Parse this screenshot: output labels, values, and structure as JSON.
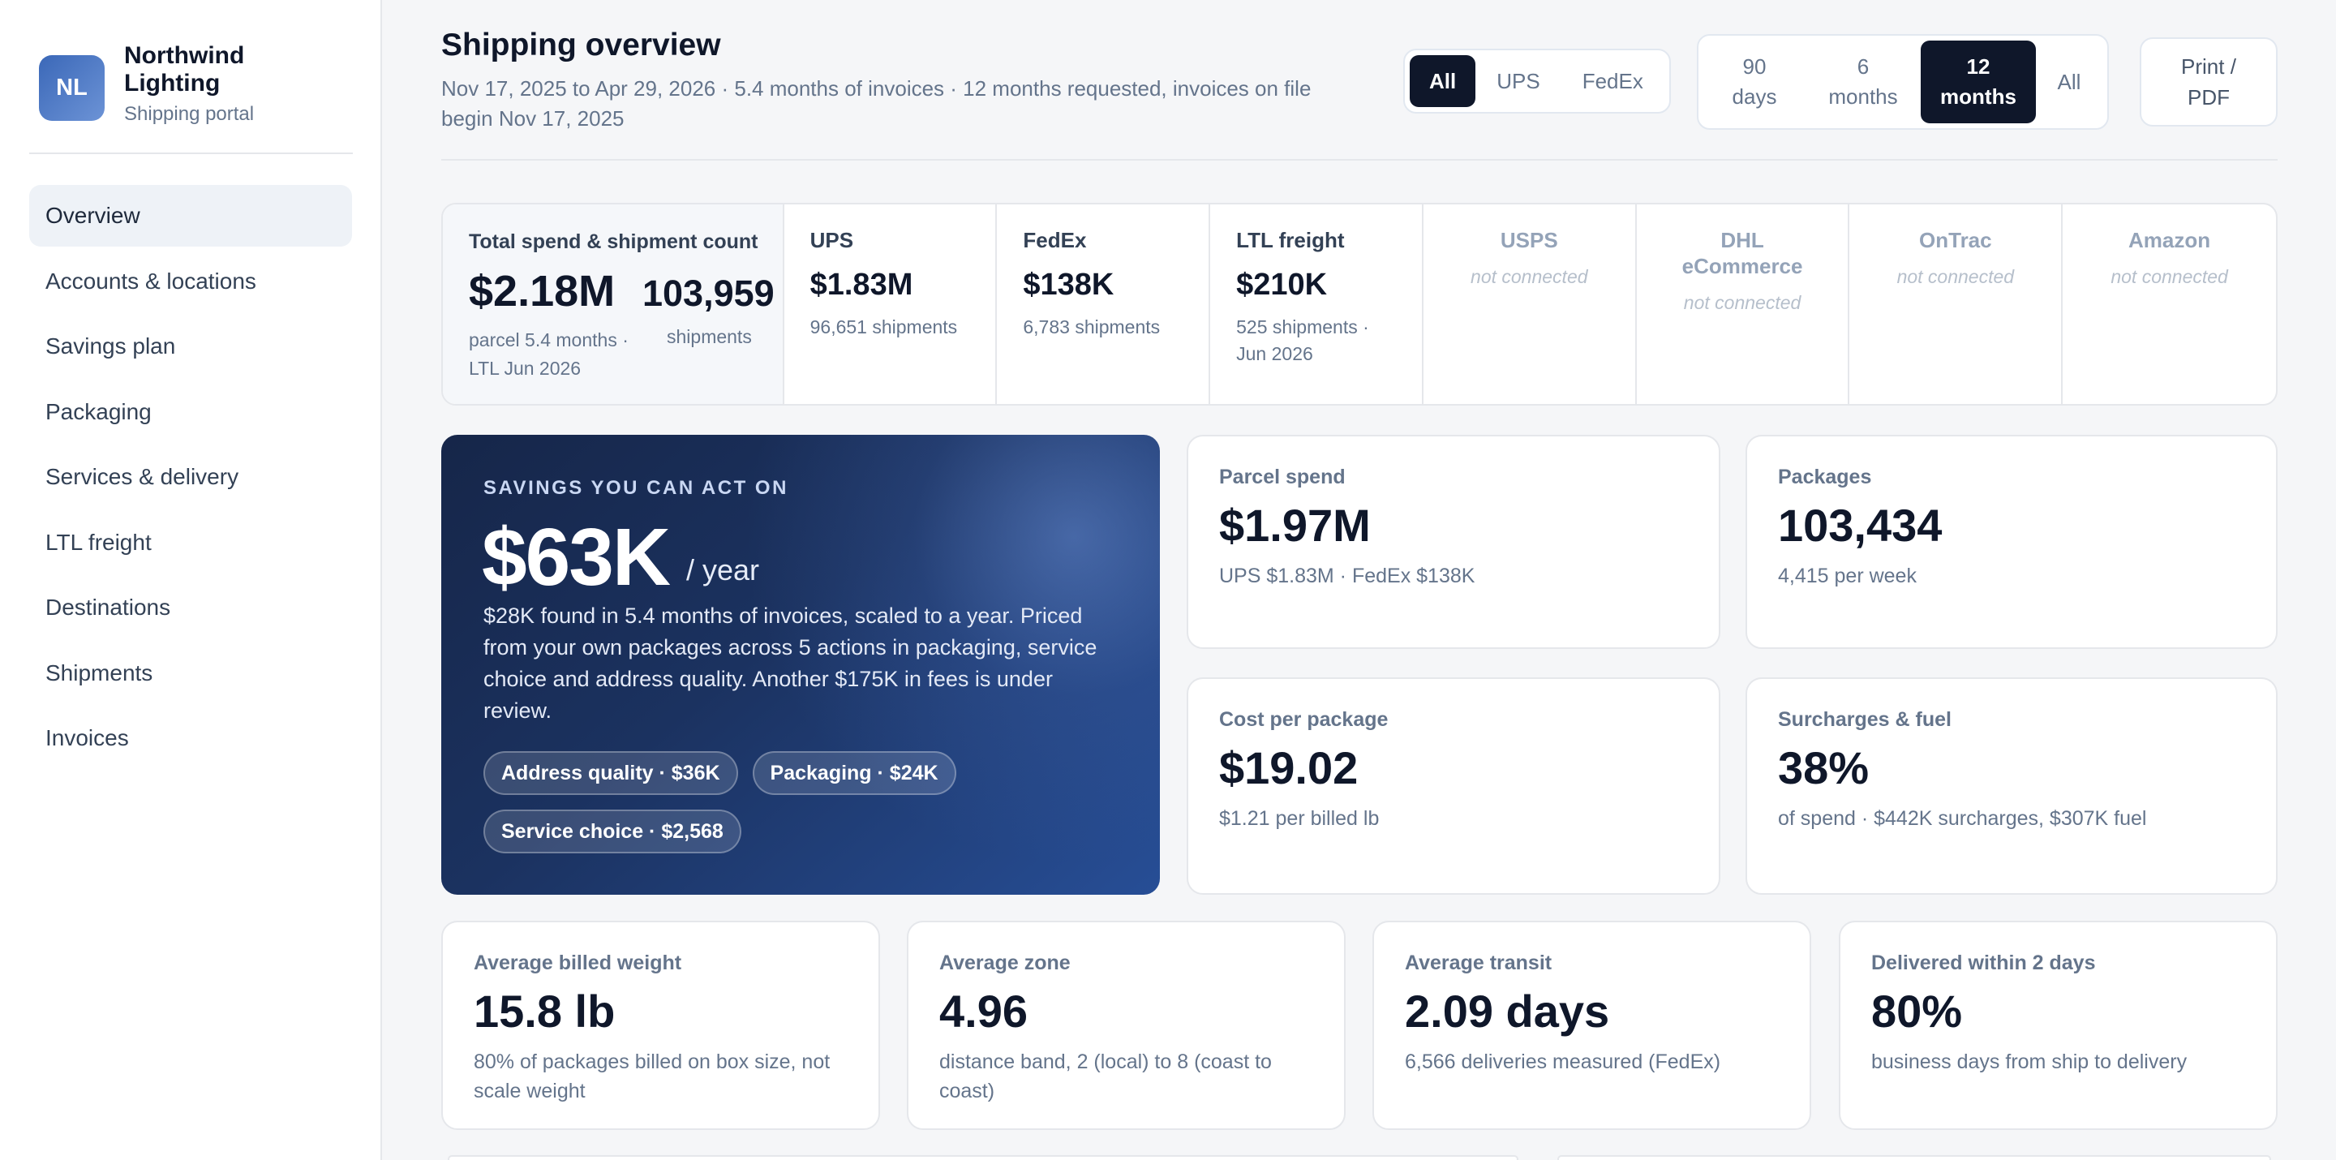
{
  "brand": {
    "initials": "NL",
    "name": "Northwind Lighting",
    "subtitle": "Shipping portal"
  },
  "nav": [
    {
      "label": "Overview",
      "active": true
    },
    {
      "label": "Accounts & locations"
    },
    {
      "label": "Savings plan"
    },
    {
      "label": "Packaging"
    },
    {
      "label": "Services & delivery"
    },
    {
      "label": "LTL freight"
    },
    {
      "label": "Destinations"
    },
    {
      "label": "Shipments"
    },
    {
      "label": "Invoices"
    }
  ],
  "header": {
    "title": "Shipping overview",
    "subtitle": "Nov 17, 2025 to Apr 29, 2026 · 5.4 months of invoices · 12 months requested, invoices on file begin Nov 17, 2025",
    "carrier_filter": {
      "options": [
        "All",
        "UPS",
        "FedEx"
      ],
      "selected": "All"
    },
    "period_filter": {
      "options": [
        "90 days",
        "6 months",
        "12 months",
        "All"
      ],
      "selected": "12 months"
    },
    "print_label": "Print / PDF"
  },
  "carrier_strip": {
    "total": {
      "label": "Total spend & shipment count",
      "spend": "$2.18M",
      "count": "103,959",
      "spend_note": "parcel 5.4 months · LTL Jun 2026",
      "count_note": "shipments"
    },
    "carriers": [
      {
        "name": "UPS",
        "value": "$1.83M",
        "detail": "96,651 shipments",
        "connected": true
      },
      {
        "name": "FedEx",
        "value": "$138K",
        "detail": "6,783 shipments",
        "connected": true
      },
      {
        "name": "LTL freight",
        "value": "$210K",
        "detail": "525 shipments · Jun 2026",
        "connected": true
      },
      {
        "name": "USPS",
        "status": "not connected",
        "connected": false
      },
      {
        "name": "DHL eCommerce",
        "status": "not connected",
        "connected": false
      },
      {
        "name": "OnTrac",
        "status": "not connected",
        "connected": false
      },
      {
        "name": "Amazon",
        "status": "not connected",
        "connected": false
      }
    ]
  },
  "savings": {
    "eyebrow": "SAVINGS YOU CAN ACT ON",
    "amount": "$63K",
    "per": "/ year",
    "description": "$28K found in 5.4 months of invoices, scaled to a year. Priced from your own packages across 5 actions in packaging, service choice and address quality. Another $175K in fees is under review.",
    "chips": [
      "Address quality · $36K",
      "Packaging · $24K",
      "Service choice · $2,568"
    ]
  },
  "metrics_mid": [
    {
      "label": "Parcel spend",
      "value": "$1.97M",
      "sub": "UPS $1.83M · FedEx $138K"
    },
    {
      "label": "Packages",
      "value": "103,434",
      "sub": "4,415 per week"
    },
    {
      "label": "Cost per package",
      "value": "$19.02",
      "sub": "$1.21 per billed lb"
    },
    {
      "label": "Surcharges & fuel",
      "value": "38%",
      "sub": "of spend · $442K surcharges, $307K fuel"
    }
  ],
  "metrics_bottom": [
    {
      "label": "Average billed weight",
      "value": "15.8 lb",
      "sub": "80% of packages billed on box size, not scale weight"
    },
    {
      "label": "Average zone",
      "value": "4.96",
      "sub": "distance band, 2 (local) to 8 (coast to coast)"
    },
    {
      "label": "Average transit",
      "value": "2.09 days",
      "sub": "6,566 deliveries measured (FedEx)"
    },
    {
      "label": "Delivered within 2 days",
      "value": "80%",
      "sub": "business days from ship to delivery"
    }
  ]
}
